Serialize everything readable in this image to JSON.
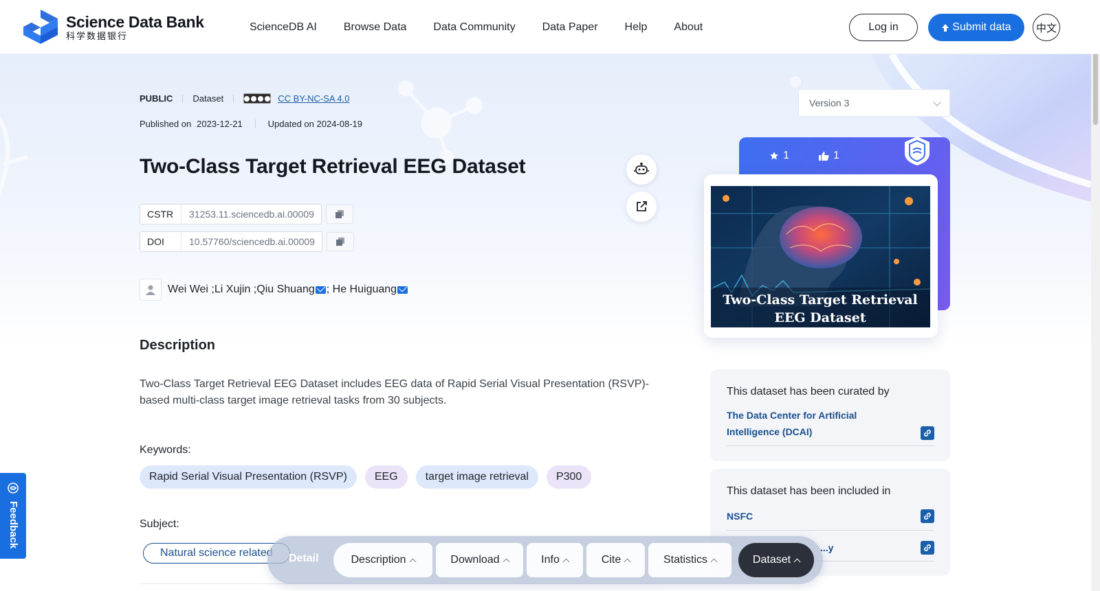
{
  "header": {
    "logo_en": "Science Data Bank",
    "logo_cn": "科学数据银行",
    "nav": [
      "ScienceDB AI",
      "Browse Data",
      "Data Community",
      "Data Paper",
      "Help",
      "About"
    ],
    "login": "Log in",
    "submit": "Submit data",
    "lang": "中文"
  },
  "dataset": {
    "visibility": "PUBLIC",
    "type": "Dataset",
    "license": "CC BY-NC-SA 4.0",
    "published_label": "Published on",
    "published_date": "2023-12-21",
    "updated": "Updated on 2024-08-19",
    "title": "Two-Class Target Retrieval EEG Dataset",
    "cstr_label": "CSTR",
    "cstr": "31253.11.sciencedb.ai.00009",
    "doi_label": "DOI",
    "doi": "10.57760/sciencedb.ai.00009",
    "authors": [
      {
        "name": "Wei Wei ; ",
        "mail": false
      },
      {
        "name": "Li Xujin ; ",
        "mail": false
      },
      {
        "name": "Qiu Shuang",
        "mail": true
      },
      {
        "name": "; He Huiguang",
        "mail": true
      }
    ]
  },
  "description": {
    "heading": "Description",
    "text": "Two-Class Target Retrieval EEG Dataset includes EEG data of Rapid Serial Visual Presentation (RSVP)-based multi-class target image retrieval tasks from 30 subjects."
  },
  "keywords": {
    "label": "Keywords:",
    "items": [
      "Rapid Serial Visual Presentation (RSVP)",
      "EEG",
      "target image retrieval",
      "P300"
    ]
  },
  "subject": {
    "label": "Subject:",
    "chip": "Natural science related"
  },
  "sidebar": {
    "version": "Version 3",
    "stars": "1",
    "likes": "1",
    "cover_caption_1": "Two-Class Target Retrieval",
    "cover_caption_2": "EEG Dataset",
    "curated_heading": "This dataset has been curated by",
    "curator": "The Data Center for Artificial Intelligence (DCAI)",
    "included_heading": "This dataset has been included in",
    "included": [
      "NSFC",
      "...y"
    ]
  },
  "bottom_nav": {
    "detail": "Detail",
    "tabs": [
      "Description",
      "Download",
      "Info",
      "Cite",
      "Statistics",
      "Dataset"
    ]
  },
  "feedback": "Feedback",
  "colors": {
    "primary": "#1a6fe0",
    "link": "#1a4f8e",
    "keyword_blue": "#dde8fb",
    "keyword_purple": "#ebe3f8"
  }
}
